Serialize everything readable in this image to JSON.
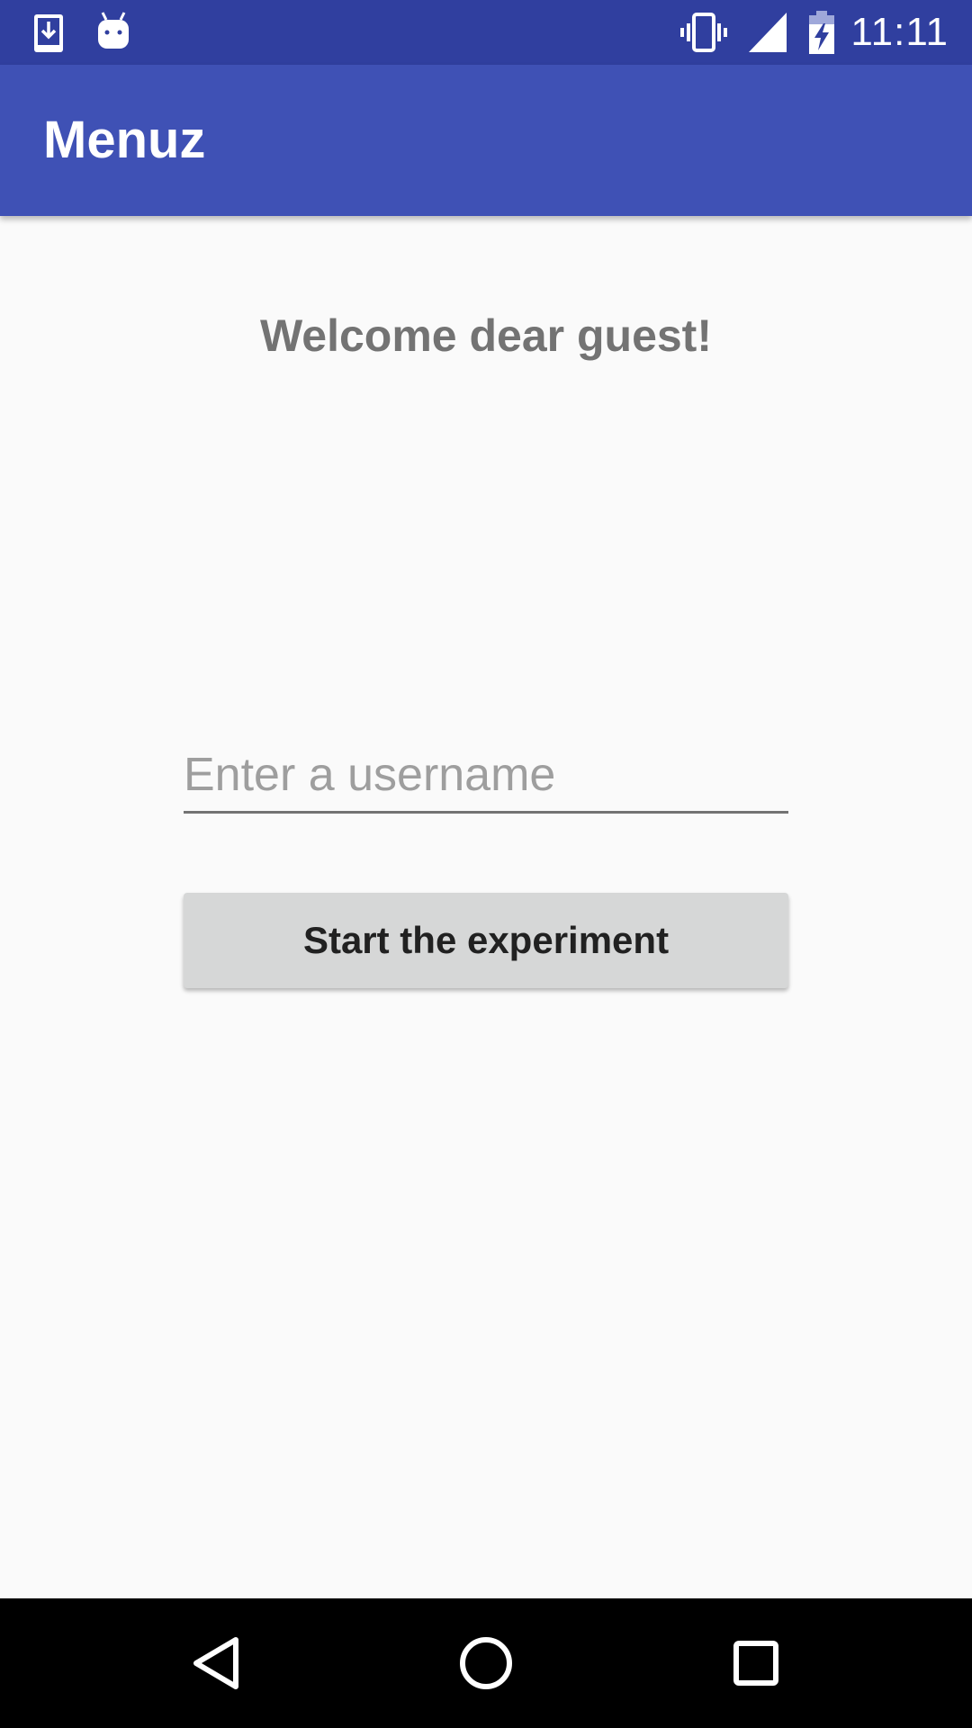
{
  "status_bar": {
    "time": "11:11",
    "icons": [
      "download-icon",
      "android-icon",
      "vibrate-icon",
      "signal-icon",
      "battery-charging-icon"
    ]
  },
  "app_bar": {
    "title": "Menuz",
    "color": "#3f51b5",
    "status_color": "#303f9f"
  },
  "main": {
    "welcome_text": "Welcome dear guest!",
    "username_placeholder": "Enter a username",
    "username_value": "",
    "start_button_label": "Start the experiment"
  },
  "nav_bar": {
    "icons": [
      "back-icon",
      "home-icon",
      "recents-icon"
    ]
  }
}
